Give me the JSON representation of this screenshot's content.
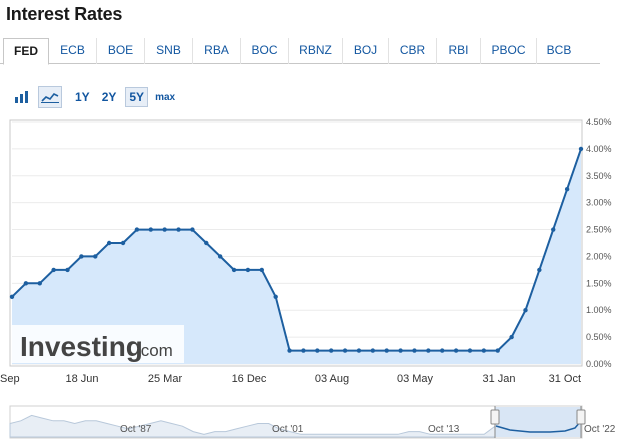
{
  "page": {
    "title": "Interest Rates"
  },
  "tabs": [
    {
      "label": "FED",
      "active": true
    },
    {
      "label": "ECB"
    },
    {
      "label": "BOE"
    },
    {
      "label": "SNB"
    },
    {
      "label": "RBA"
    },
    {
      "label": "BOC"
    },
    {
      "label": "RBNZ"
    },
    {
      "label": "BOJ"
    },
    {
      "label": "CBR"
    },
    {
      "label": "RBI"
    },
    {
      "label": "PBOC"
    },
    {
      "label": "BCB"
    }
  ],
  "toolbar": {
    "chart_types": [
      {
        "icon": "bar-chart-icon",
        "active": false
      },
      {
        "icon": "line-chart-icon",
        "active": true
      }
    ],
    "ranges": [
      "1Y",
      "2Y",
      "5Y",
      "max"
    ],
    "active_range": "5Y"
  },
  "watermark": {
    "brand": "Investing",
    "suffix": ".com"
  },
  "colors": {
    "line": "#1d5fa0",
    "fill": "#d6e8fb",
    "link": "#1256a0"
  },
  "chart_data": {
    "type": "area",
    "title": "",
    "xlabel": "",
    "ylabel": "",
    "x_tick_labels": [
      "Sep",
      "18 Jun",
      "25 Mar",
      "16 Dec",
      "03 Aug",
      "03 May",
      "31 Jan",
      "31 Oct"
    ],
    "y_tick_labels": [
      "0.00%",
      "0.50%",
      "1.00%",
      "1.50%",
      "2.00%",
      "2.50%",
      "3.00%",
      "3.50%",
      "4.00%",
      "4.50%"
    ],
    "ylim": [
      0,
      4.5
    ],
    "grid": "horizontal",
    "values": [
      1.25,
      1.5,
      1.5,
      1.75,
      1.75,
      2.0,
      2.0,
      2.25,
      2.25,
      2.5,
      2.5,
      2.5,
      2.5,
      2.5,
      2.25,
      2.0,
      1.75,
      1.75,
      1.75,
      1.25,
      0.25,
      0.25,
      0.25,
      0.25,
      0.25,
      0.25,
      0.25,
      0.25,
      0.25,
      0.25,
      0.25,
      0.25,
      0.25,
      0.25,
      0.25,
      0.25,
      0.5,
      1.0,
      1.75,
      2.5,
      3.25,
      4.0
    ],
    "navigator": {
      "labels": [
        "Oct '87",
        "Oct '01",
        "Oct '13",
        "Oct '22"
      ]
    }
  }
}
